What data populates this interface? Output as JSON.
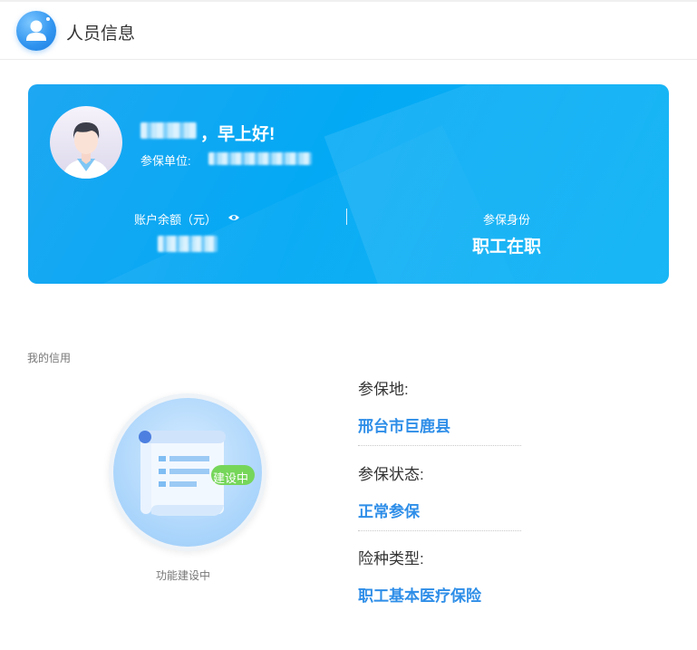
{
  "header": {
    "title": "人员信息",
    "icon": "user-icon"
  },
  "card": {
    "greeting": "，早上好!",
    "unit_label": "参保单位:",
    "balance_label": "账户余额（元）",
    "identity_label": "参保身份",
    "identity_value": "职工在职",
    "accent_color": "#03a9f4"
  },
  "credit": {
    "title": "我的信用",
    "badge": "建设中",
    "caption": "功能建设中"
  },
  "info": [
    {
      "label": "参保地:",
      "value": "邢台市巨鹿县"
    },
    {
      "label": "参保状态:",
      "value": "正常参保"
    },
    {
      "label": "险种类型:",
      "value": "职工基本医疗保险"
    }
  ],
  "colors": {
    "value_blue": "#2e8ee8",
    "card_blue": "#03a9f4"
  }
}
